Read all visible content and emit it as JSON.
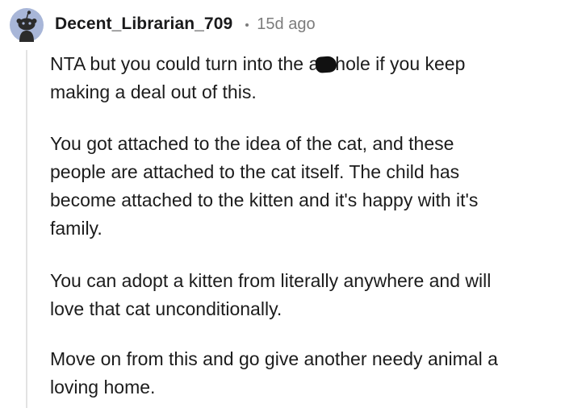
{
  "comment": {
    "author": "Decent_Librarian_709",
    "timestamp": "15d ago",
    "avatar_icon": "reddit-snoo-avatar-icon",
    "colors": {
      "avatar_bg": "#a8b6d8",
      "username": "#1a1a1b",
      "meta": "#7c7c7c",
      "thread_line": "#e3e3e3"
    },
    "paragraph1": {
      "line1_before": "NTA but you could turn into the a",
      "line1_after": "hole if you keep",
      "line2": "making a deal out of this."
    },
    "paragraph2": {
      "line1": "You got attached to the idea of the cat, and these",
      "line2": "people are attached to the cat itself. The child has",
      "line3": "become attached to the kitten and it's happy with it's",
      "line4": "family."
    },
    "paragraph3": {
      "line1": "You can adopt a kitten from literally anywhere and will",
      "line2": "love that cat unconditionally."
    },
    "paragraph4": {
      "line1": "Move on from this and go give another needy animal a",
      "line2": "loving home."
    }
  }
}
